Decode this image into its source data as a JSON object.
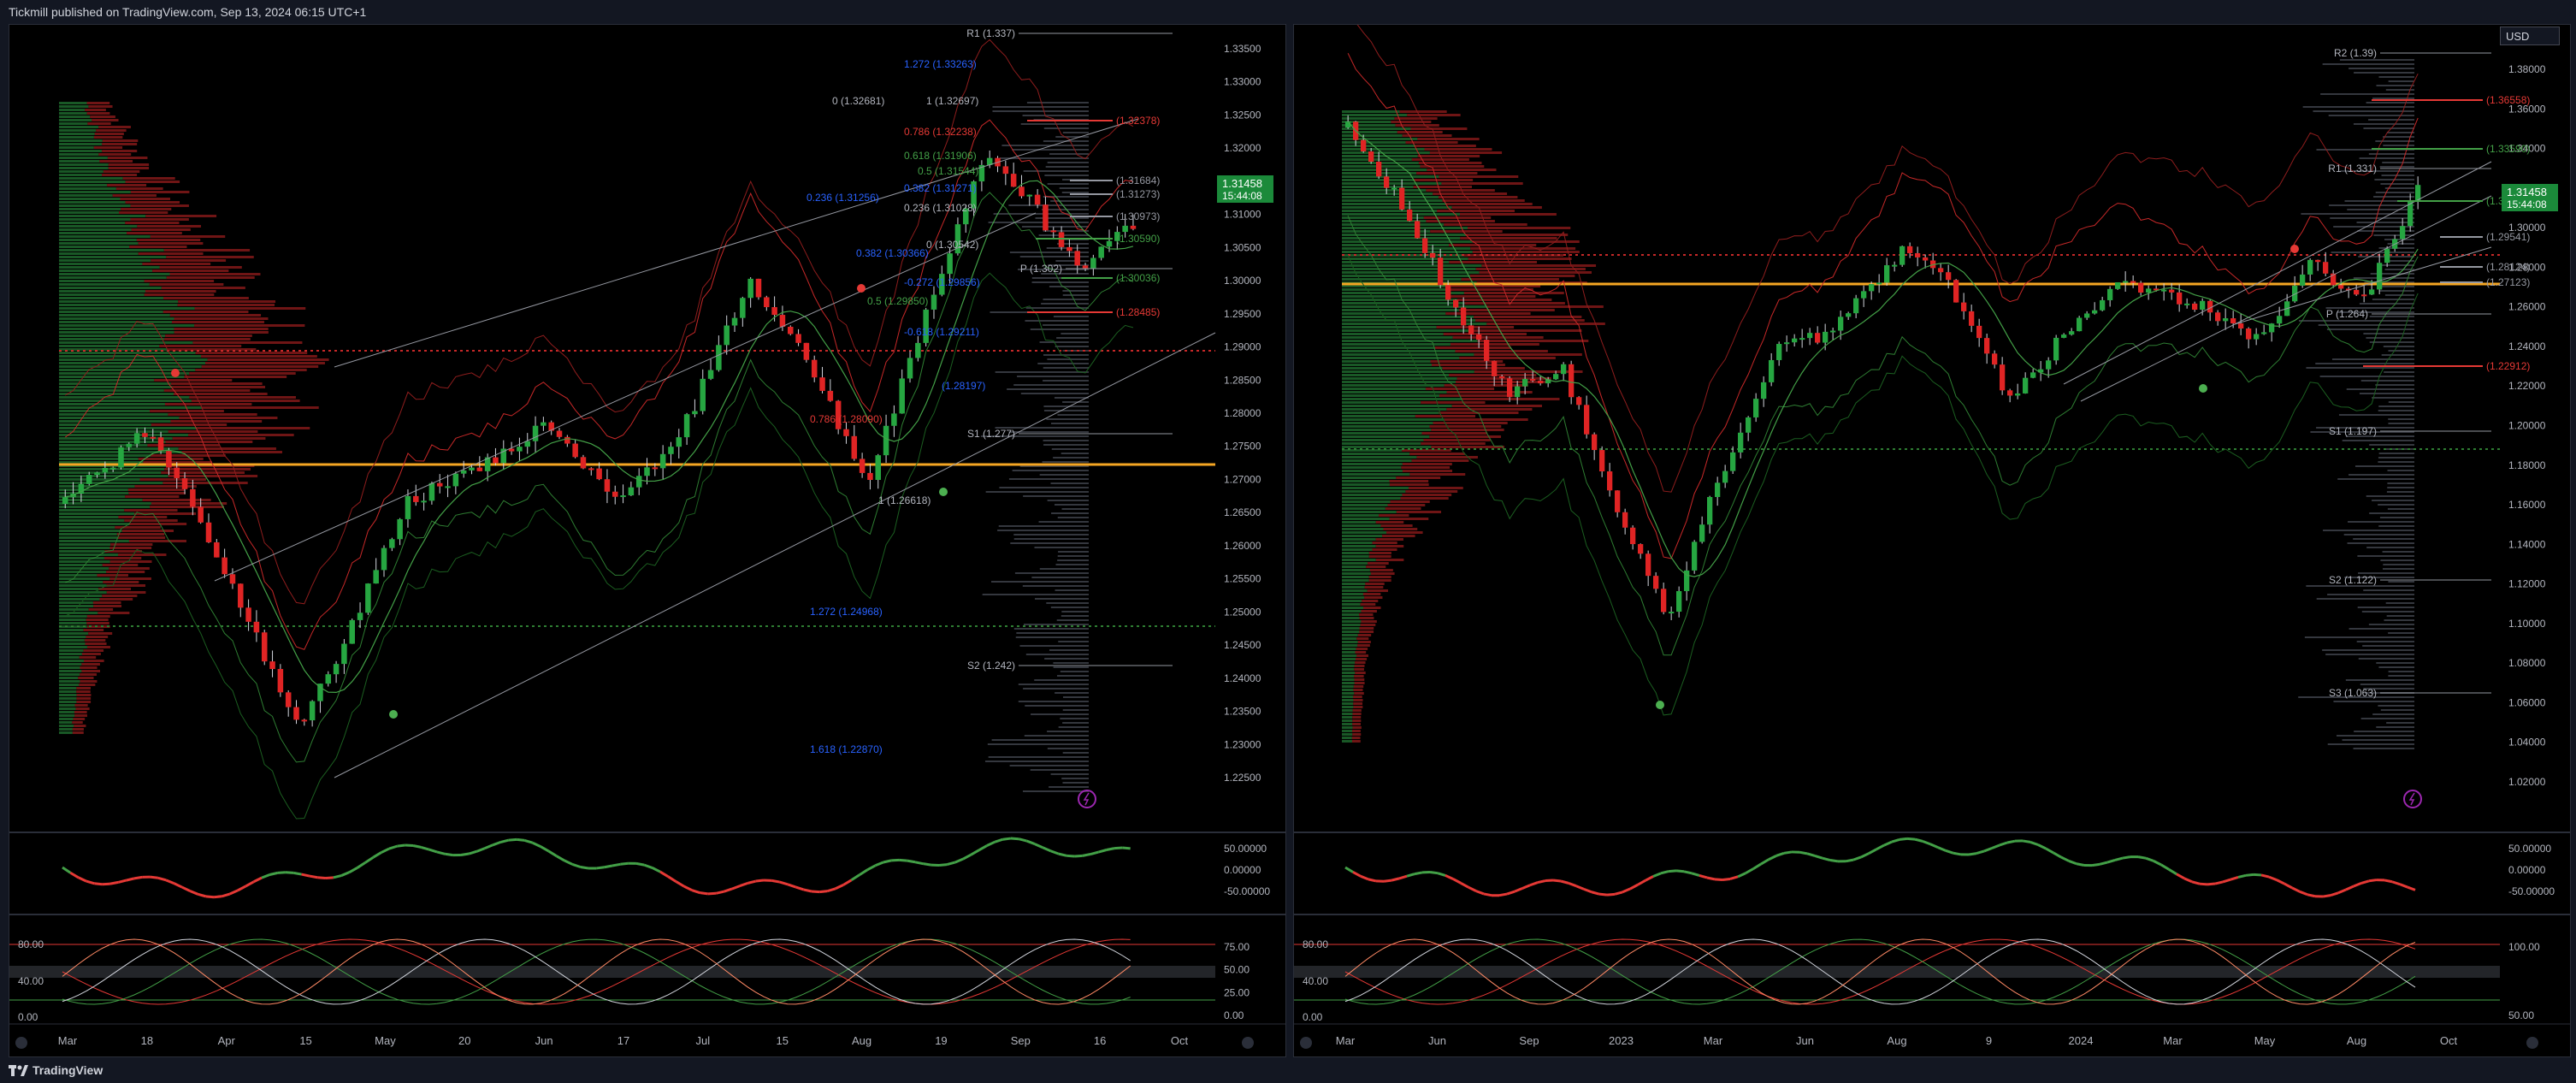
{
  "header": {
    "publisher_line": "Tickmill published on TradingView.com, Sep 13, 2024 06:15 UTC+1"
  },
  "footer": {
    "brand": "TradingView"
  },
  "colors": {
    "bull": "#26a641",
    "bear": "#e02424",
    "poc": "#f5a623",
    "fib": "#2962ff",
    "bg": "#000000",
    "axis_text": "#b2b5be"
  },
  "left_chart": {
    "price_axis": [
      "1.33500",
      "1.33000",
      "1.32500",
      "1.32000",
      "1.31500",
      "1.31000",
      "1.30500",
      "1.30000",
      "1.29500",
      "1.29000",
      "1.28500",
      "1.28000",
      "1.27500",
      "1.27000",
      "1.26500",
      "1.26000",
      "1.25500",
      "1.25000",
      "1.24500",
      "1.24000",
      "1.23500",
      "1.23000",
      "1.22500"
    ],
    "time_axis": [
      "Mar",
      "18",
      "Apr",
      "15",
      "May",
      "20",
      "Jun",
      "17",
      "Jul",
      "15",
      "Aug",
      "19",
      "Sep",
      "16",
      "Oct"
    ],
    "current_price": "1.31458",
    "countdown": "15:44:08",
    "pivot_labels": [
      "R1 (1.337)",
      "P (1.302)",
      "S1 (1.277)",
      "S2 (1.242)"
    ],
    "fib_up_labels": [
      "1.272 (1.33263)",
      "0.236 (1.31256)",
      "0.382 (1.30366)",
      "-0.272 (1.29856)",
      "-0.618 (1.29211)",
      "(1.28197)",
      "1.272 (1.24968)",
      "1.618 (1.22870)"
    ],
    "fib_down_labels": [
      "0 (1.32681)",
      "0.5 (1.29850)",
      "0.786 (1.28090)",
      "1 (1.26618)"
    ],
    "fib_inner_labels": [
      "1 (1.32697)",
      "0.786 (1.32238)",
      "0.618 (1.31906)",
      "0.5 (1.31544)",
      "0.382 (1.31271)",
      "0.236 (1.31028)",
      "0 (1.30542)"
    ],
    "right_side_labels": [
      "(1.32378)",
      "(1.31684)",
      "(1.31273)",
      "(1.30973)",
      "(1.30590)",
      "(1.30036)",
      "(1.28485)"
    ],
    "osc_axis": [
      "50.00000",
      "0.00000",
      "-50.00000"
    ],
    "stoch_left_axis": [
      "80.00",
      "40.00",
      "0.00"
    ],
    "stoch_right_axis": [
      "75.00",
      "50.00",
      "25.00",
      "0.00"
    ]
  },
  "right_chart": {
    "currency": "USD",
    "price_axis": [
      "1.38000",
      "1.36000",
      "1.34000",
      "1.32000",
      "1.30000",
      "1.28000",
      "1.26000",
      "1.24000",
      "1.22000",
      "1.20000",
      "1.18000",
      "1.16000",
      "1.14000",
      "1.12000",
      "1.10000",
      "1.08000",
      "1.06000",
      "1.04000",
      "1.02000"
    ],
    "time_axis": [
      "Mar",
      "Jun",
      "Sep",
      "2023",
      "Mar",
      "Jun",
      "Aug",
      "9",
      "2024",
      "Mar",
      "May",
      "Aug",
      "Oct"
    ],
    "current_price": "1.31458",
    "countdown": "15:44:08",
    "pivot_labels": [
      "R2 (1.39)",
      "R1 (1.331)",
      "P (1.264)",
      "S1 (1.197)",
      "S2 (1.122)",
      "S3 (1.063)"
    ],
    "level_labels": [
      "(1.36558)",
      "(1.33590)",
      "(1.31346)",
      "(1.29541)",
      "(1.28124)",
      "(1.27123)",
      "(1.22912)"
    ],
    "osc_axis": [
      "50.00000",
      "0.00000",
      "-50.00000"
    ],
    "stoch_left_axis": [
      "80.00",
      "40.00",
      "0.00"
    ],
    "stoch_right_axis": [
      "100.00",
      "50.00"
    ]
  }
}
